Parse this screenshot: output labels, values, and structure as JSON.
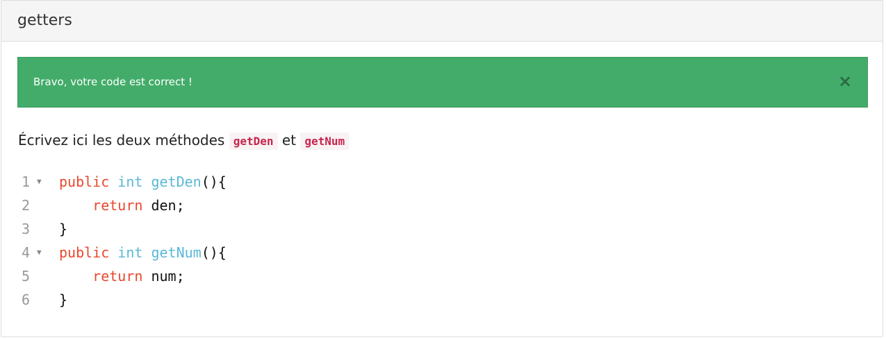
{
  "panel": {
    "title": "getters"
  },
  "alert": {
    "message": "Bravo, votre code est correct !",
    "close_symbol": "×"
  },
  "instruction": {
    "before": "Écrivez ici les deux méthodes",
    "code1": "getDen",
    "between": "et",
    "code2": "getNum"
  },
  "code": {
    "lines": [
      {
        "num": "1",
        "fold": "▼",
        "indent": "",
        "tokens": [
          [
            "kw",
            "public"
          ],
          [
            "pl",
            " "
          ],
          [
            "ty",
            "int"
          ],
          [
            "pl",
            " "
          ],
          [
            "fn",
            "getDen"
          ],
          [
            "pl",
            "(){"
          ]
        ]
      },
      {
        "num": "2",
        "fold": "",
        "indent": "    ",
        "tokens": [
          [
            "kw",
            "return"
          ],
          [
            "pl",
            " den;"
          ]
        ]
      },
      {
        "num": "3",
        "fold": "",
        "indent": "",
        "tokens": [
          [
            "pl",
            "}"
          ]
        ]
      },
      {
        "num": "4",
        "fold": "▼",
        "indent": "",
        "tokens": [
          [
            "kw",
            "public"
          ],
          [
            "pl",
            " "
          ],
          [
            "ty",
            "int"
          ],
          [
            "pl",
            " "
          ],
          [
            "fn",
            "getNum"
          ],
          [
            "pl",
            "(){"
          ]
        ]
      },
      {
        "num": "5",
        "fold": "",
        "indent": "    ",
        "tokens": [
          [
            "kw",
            "return"
          ],
          [
            "pl",
            " num;"
          ]
        ]
      },
      {
        "num": "6",
        "fold": "",
        "indent": "",
        "tokens": [
          [
            "pl",
            "}"
          ]
        ]
      }
    ]
  },
  "colors": {
    "alert_bg": "#43ac6a",
    "keyword": "#e8482e",
    "type": "#59b8d6",
    "inline_code": "#c7254e"
  }
}
